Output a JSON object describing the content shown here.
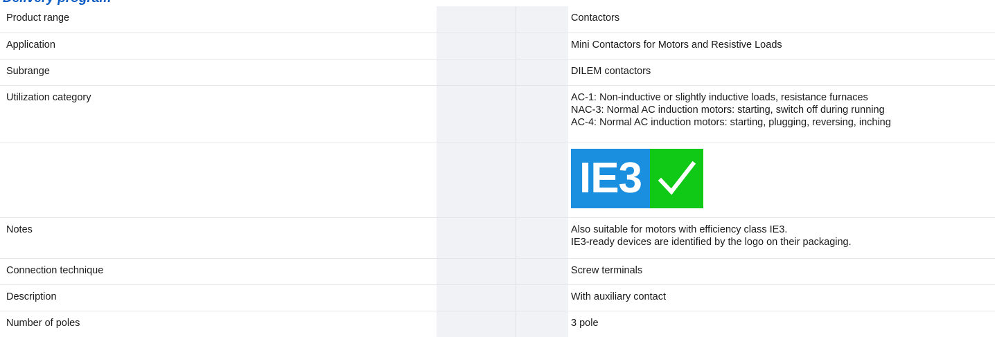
{
  "section": {
    "heading": "Delivery program"
  },
  "rows": [
    {
      "label": "Product range",
      "values": [
        "Contactors"
      ]
    },
    {
      "label": "Application",
      "values": [
        "Mini Contactors for Motors and Resistive Loads"
      ]
    },
    {
      "label": "Subrange",
      "values": [
        "DILEM contactors"
      ]
    },
    {
      "label": "Utilization category",
      "values": [
        "AC-1: Non-inductive or slightly inductive loads, resistance furnaces",
        "NAC-3: Normal AC induction motors: starting, switch off during running",
        "AC-4: Normal AC induction motors: starting, plugging, reversing, inching"
      ]
    },
    {
      "label": "",
      "logo": {
        "text": "IE3",
        "left_color": "#1a8fe0",
        "right_color": "#10c816",
        "icon": "checkmark-icon"
      }
    },
    {
      "label": "Notes",
      "values": [
        "Also suitable for motors with efficiency class IE3.",
        "IE3-ready devices are identified by the logo on their packaging."
      ]
    },
    {
      "label": "Connection technique",
      "values": [
        "Screw terminals"
      ]
    },
    {
      "label": "Description",
      "values": [
        "With auxiliary contact"
      ]
    },
    {
      "label": "Number of poles",
      "values": [
        "3 pole"
      ]
    }
  ]
}
